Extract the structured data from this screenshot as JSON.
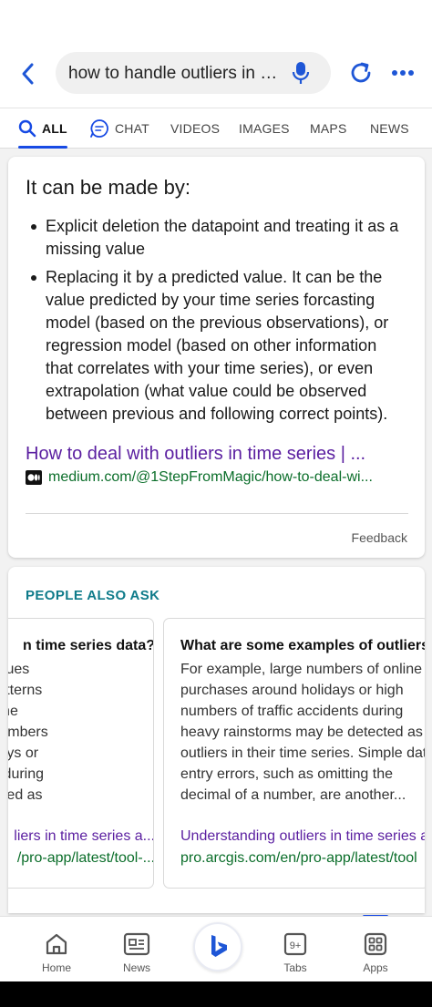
{
  "colors": {
    "accent": "#174ae4",
    "link_visited": "#5a1ea0",
    "url_green": "#0b6e2a",
    "paa_teal": "#0f7b8a"
  },
  "header": {
    "back_icon": "chevron-left-icon",
    "search_query": "how to handle outliers in ti...",
    "mic_icon": "microphone-icon",
    "refresh_icon": "refresh-icon",
    "more_icon": "more-dots-icon"
  },
  "tabs": [
    {
      "label": "ALL",
      "active": true,
      "icon": "search-icon"
    },
    {
      "label": "CHAT",
      "active": false,
      "icon": "chat-icon"
    },
    {
      "label": "VIDEOS",
      "active": false
    },
    {
      "label": "IMAGES",
      "active": false
    },
    {
      "label": "MAPS",
      "active": false
    },
    {
      "label": "NEWS",
      "active": false
    }
  ],
  "answer": {
    "heading": "It can be made by:",
    "bullets": [
      "Explicit deletion the datapoint and treating it as a missing value",
      "Replacing it by a predicted value. It can be the value predicted by your time series forcasting model (based on the previous observations), or regression model (based on other information that correlates with your time series), or even extrapolation (what value could be observed between previous and following correct points)."
    ],
    "source_title": "How to deal with outliers in time series | ...",
    "source_url": "medium.com/@1StepFromMagic/how-to-deal-wi...",
    "source_icon": "medium-logo-icon",
    "feedback": "Feedback"
  },
  "people_also_ask": {
    "title": "PEOPLE ALSO ASK",
    "cards": [
      {
        "question": "n time series data?",
        "answer_lines": [
          "ies data are values",
          "ffer from the patterns",
          "ther values in the",
          "ample, large numbers",
          "s around holidays or",
          "affic accidents during",
          "nay be detected as..."
        ],
        "link_title": "liers in time series a...",
        "link_url": "/pro-app/latest/tool-..."
      },
      {
        "question": "What are some examples of outliers?",
        "answer_lines": [
          "For example, large numbers of online",
          "purchases around holidays or high",
          "numbers of traffic accidents during",
          "heavy rainstorms may be detected as",
          "outliers in their time series. Simple dat",
          "entry errors, such as omitting the",
          "decimal of a number, are another..."
        ],
        "link_title": "Understanding outliers in time series a",
        "link_url": "pro.arcgis.com/en/pro-app/latest/tool"
      }
    ]
  },
  "bottom_nav": {
    "home": {
      "label": "Home",
      "icon": "home-icon"
    },
    "news": {
      "label": "News",
      "icon": "news-icon"
    },
    "bing": {
      "icon": "bing-logo-icon"
    },
    "tabs": {
      "label": "Tabs",
      "count": "9+",
      "icon": "tabs-icon"
    },
    "apps": {
      "label": "Apps",
      "icon": "apps-grid-icon",
      "active": true
    }
  }
}
